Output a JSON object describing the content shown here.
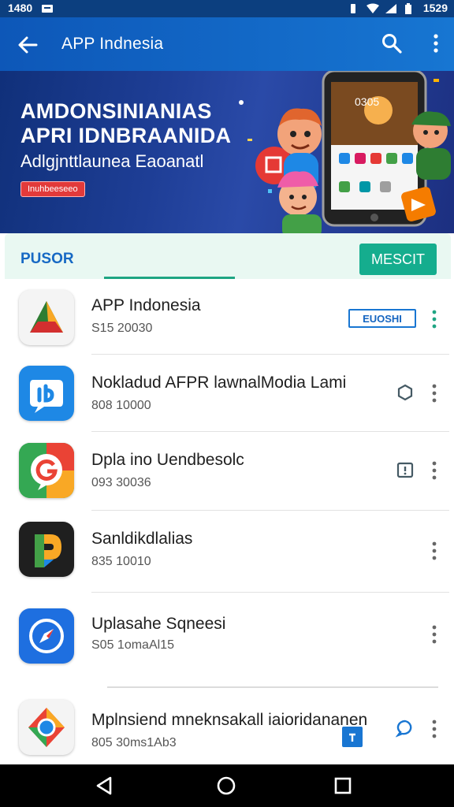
{
  "status_bar": {
    "time": "1480",
    "right_time": "1529"
  },
  "app_bar": {
    "title": "APP Indnesia"
  },
  "banner": {
    "headline_line1": "AMDONSINIANIAS",
    "headline_line2": "APRI IDNBRAANIDA",
    "subtitle": "Adlgjnttlaunea Eaoanatl",
    "pill": "Inuhbeeseeo",
    "phone_screen_text": "0305"
  },
  "tabs": {
    "active_tab": "PUSOR",
    "action_button": "MESCIT"
  },
  "apps": [
    {
      "name": "APP Indonesia",
      "meta": "S15 20030",
      "action_label": "EUOSHI",
      "action_type": "tag"
    },
    {
      "name": "Nokladud AFPR lawnalModia Lami",
      "meta": "808 10000",
      "action_type": "hex"
    },
    {
      "name": "Dpla ino Uendbesolc",
      "meta": "093 30036",
      "action_type": "box"
    },
    {
      "name": "Sanldikdlalias",
      "meta": "835 10010",
      "action_type": "none"
    },
    {
      "name": "Uplasahe Sqneesi",
      "meta": "S05 1omaAl15",
      "action_type": "none"
    },
    {
      "name": "Mplnsiend mneknsakall iaioridananen",
      "meta": "805 30ms1Ab3",
      "action_type": "chat"
    }
  ],
  "colors": {
    "primary": "#1565c0",
    "accent": "#15ad8e",
    "tab_text": "#1769c4"
  }
}
